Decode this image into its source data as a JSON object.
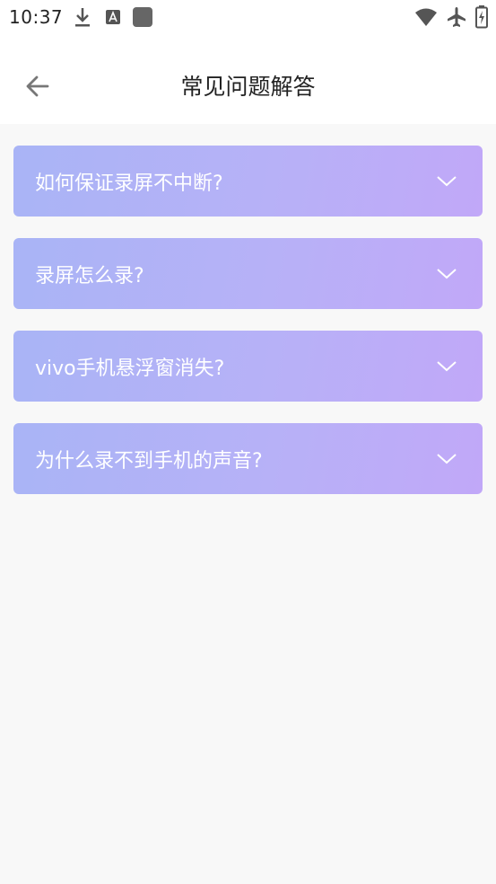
{
  "status_bar": {
    "time": "10:37",
    "icons": [
      "download-icon",
      "text-a-icon",
      "app-square-icon",
      "wifi-icon",
      "airplane-icon",
      "battery-charging-icon"
    ]
  },
  "header": {
    "title": "常见问题解答",
    "back_icon": "arrow-left-icon"
  },
  "faq": {
    "items": [
      {
        "question": "如何保证录屏不中断?"
      },
      {
        "question": "录屏怎么录?"
      },
      {
        "question": "vivo手机悬浮窗消失?"
      },
      {
        "question": "为什么录不到手机的声音?"
      }
    ]
  },
  "colors": {
    "card_gradient_start": "#a9b4f6",
    "card_gradient_end": "#c1a8f8",
    "background": "#f8f8f8"
  }
}
